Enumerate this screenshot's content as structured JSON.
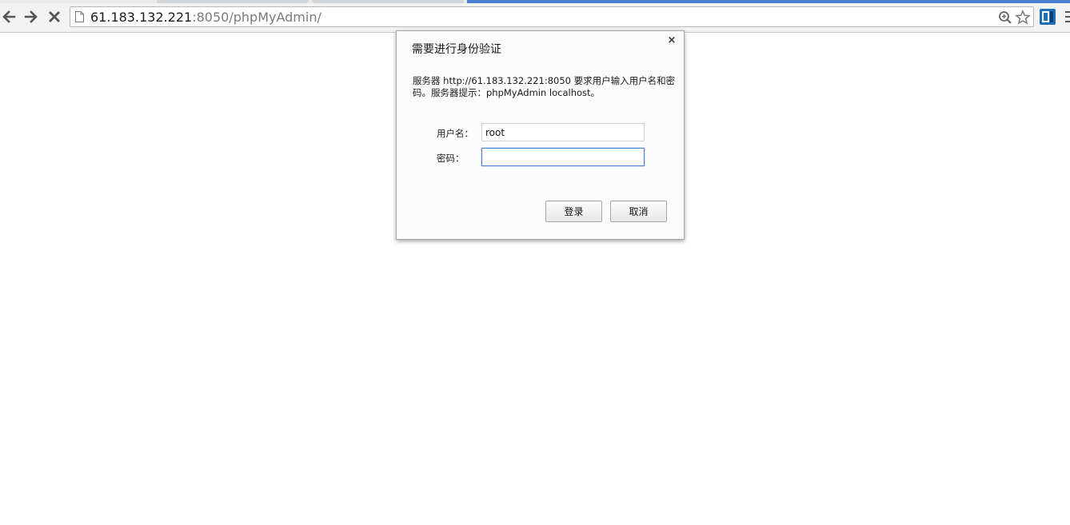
{
  "browser": {
    "url_host": "61.183.132.221",
    "url_rest": ":8050/phpMyAdmin/",
    "back_icon": "back-arrow-icon",
    "forward_icon": "forward-arrow-icon",
    "stop_icon": "stop-x-icon",
    "accent_color": "#4d7fd1"
  },
  "dialog": {
    "title": "需要进行身份验证",
    "message": "服务器 http://61.183.132.221:8050 要求用户输入用户名和密码。服务器提示：phpMyAdmin localhost。",
    "username_label": "用户名：",
    "username_value": "root",
    "password_label": "密码：",
    "password_value": "",
    "login_label": "登录",
    "cancel_label": "取消",
    "close_label": "×"
  }
}
